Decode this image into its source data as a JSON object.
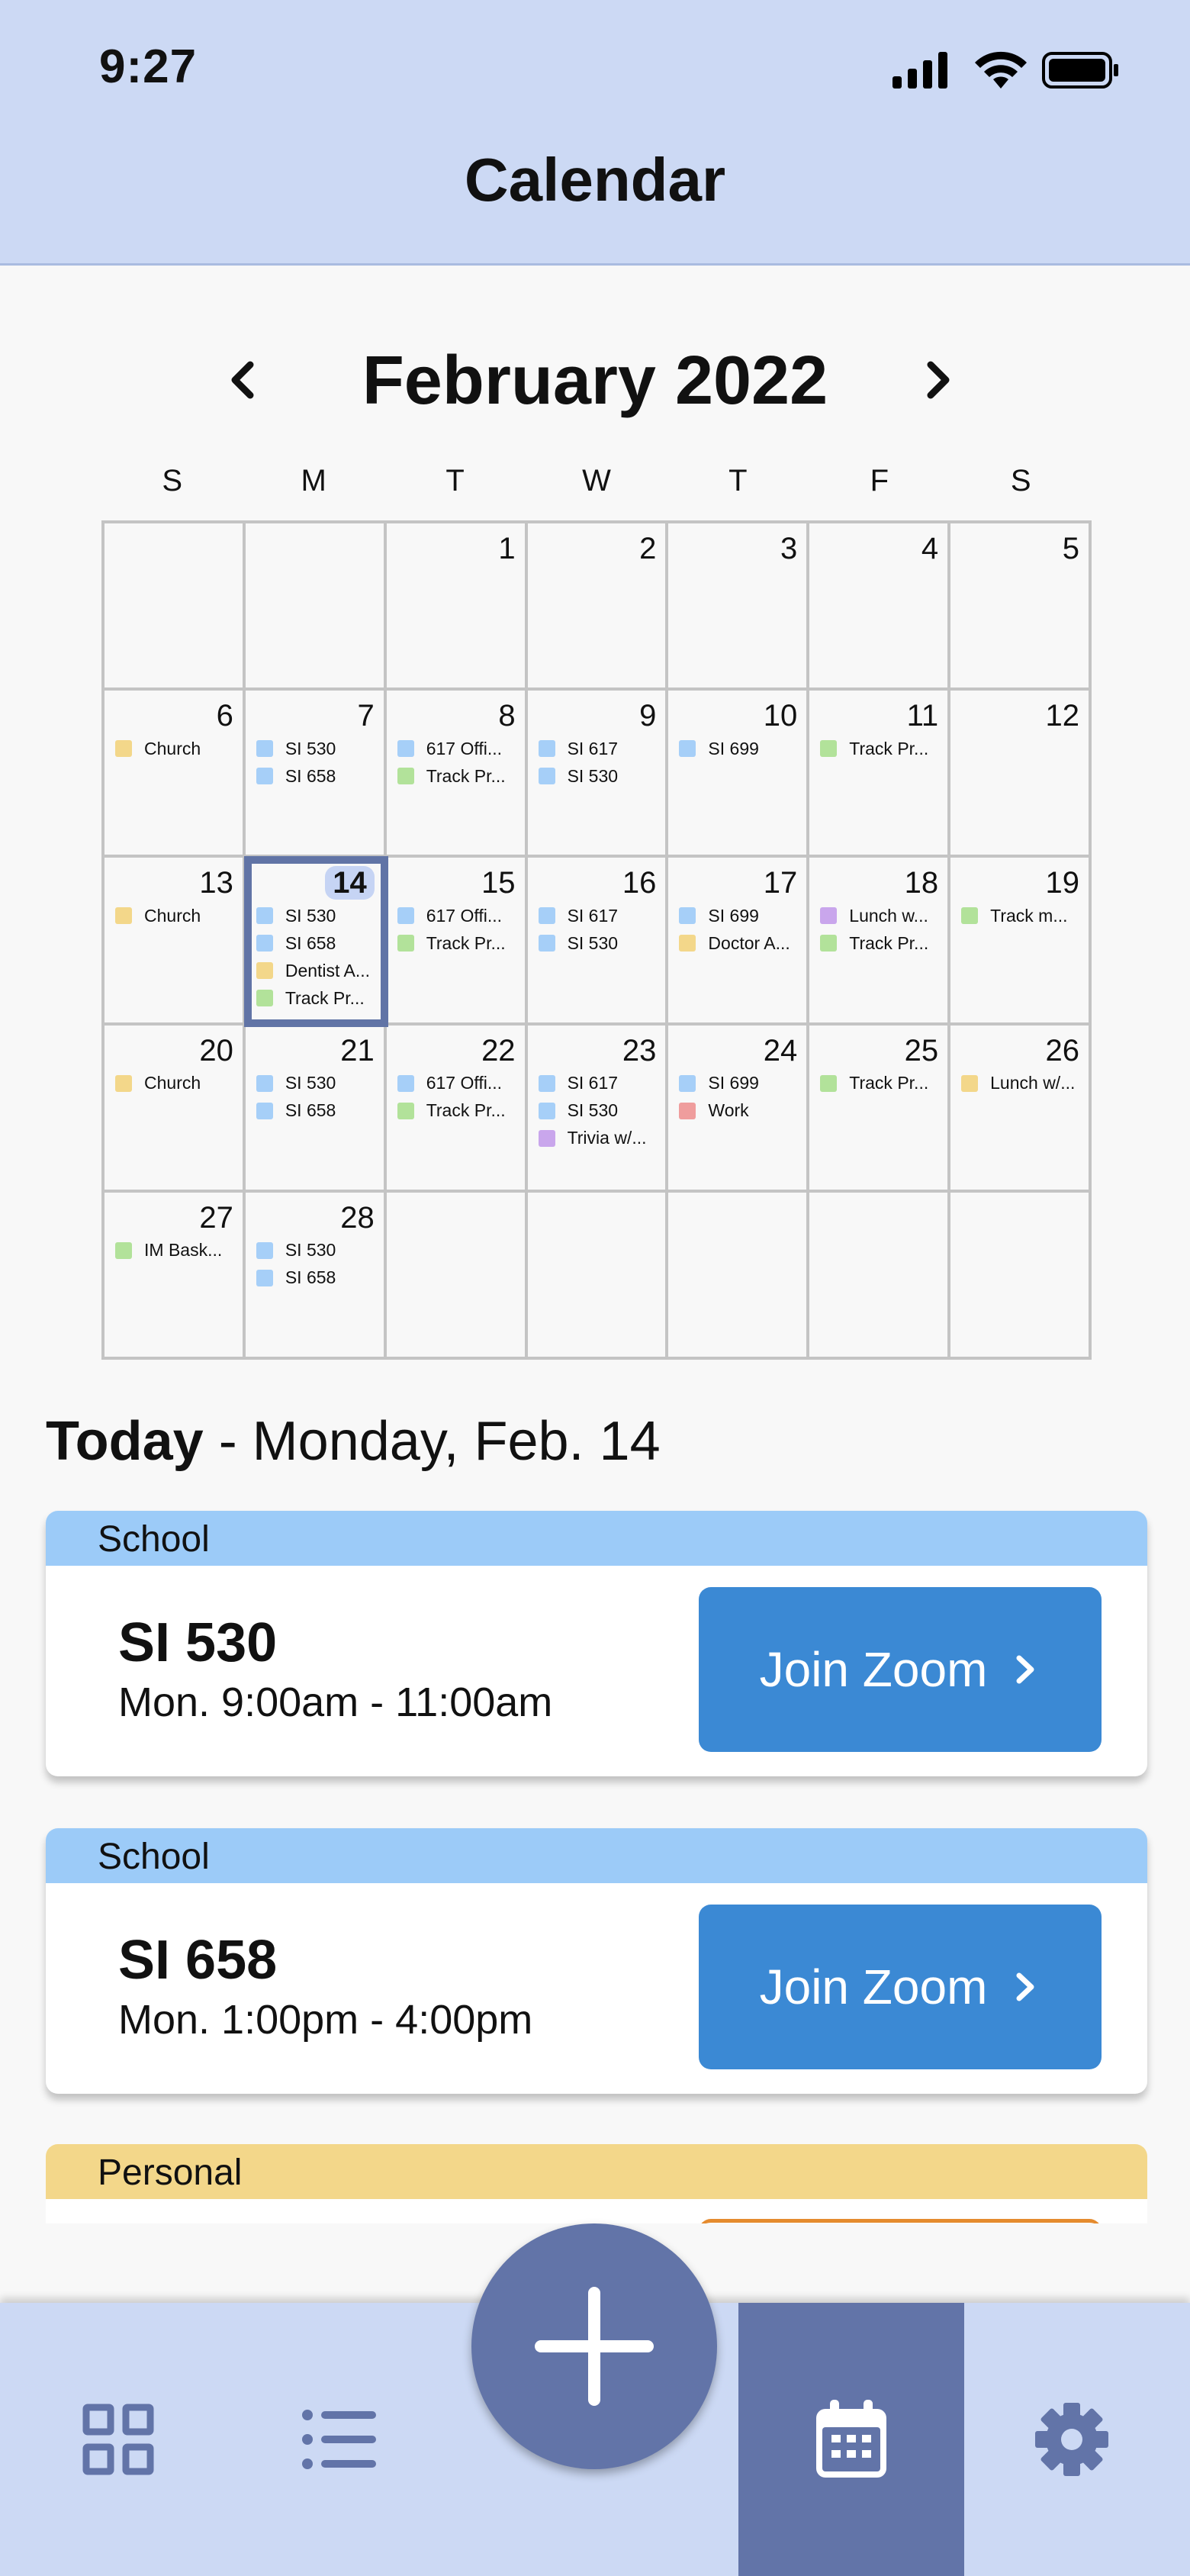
{
  "status_bar": {
    "time": "9:27"
  },
  "header": {
    "title": "Calendar"
  },
  "month": {
    "label": "February 2022"
  },
  "weekdays": [
    "S",
    "M",
    "T",
    "W",
    "T",
    "F",
    "S"
  ],
  "category_colors": {
    "school": "#a6cff8",
    "personal": "#f3d78a",
    "fitness": "#b2e29a",
    "social": "#c9a6ec",
    "work": "#ef9d9d"
  },
  "calendar": {
    "weeks": [
      [
        {
          "day": "",
          "events": []
        },
        {
          "day": "",
          "events": []
        },
        {
          "day": "1",
          "events": []
        },
        {
          "day": "2",
          "events": []
        },
        {
          "day": "3",
          "events": []
        },
        {
          "day": "4",
          "events": []
        },
        {
          "day": "5",
          "events": []
        }
      ],
      [
        {
          "day": "6",
          "events": [
            {
              "label": "Church",
              "category": "personal"
            }
          ]
        },
        {
          "day": "7",
          "events": [
            {
              "label": "SI 530",
              "category": "school"
            },
            {
              "label": "SI 658",
              "category": "school"
            }
          ]
        },
        {
          "day": "8",
          "events": [
            {
              "label": "617 Offi...",
              "category": "school"
            },
            {
              "label": "Track Pr...",
              "category": "fitness"
            }
          ]
        },
        {
          "day": "9",
          "events": [
            {
              "label": "SI 617",
              "category": "school"
            },
            {
              "label": "SI 530",
              "category": "school"
            }
          ]
        },
        {
          "day": "10",
          "events": [
            {
              "label": "SI 699",
              "category": "school"
            }
          ]
        },
        {
          "day": "11",
          "events": [
            {
              "label": "Track Pr...",
              "category": "fitness"
            }
          ]
        },
        {
          "day": "12",
          "events": []
        }
      ],
      [
        {
          "day": "13",
          "events": [
            {
              "label": "Church",
              "category": "personal"
            }
          ]
        },
        {
          "day": "14",
          "today": true,
          "events": [
            {
              "label": "SI 530",
              "category": "school"
            },
            {
              "label": "SI 658",
              "category": "school"
            },
            {
              "label": "Dentist A...",
              "category": "personal"
            },
            {
              "label": "Track Pr...",
              "category": "fitness"
            }
          ]
        },
        {
          "day": "15",
          "events": [
            {
              "label": "617 Offi...",
              "category": "school"
            },
            {
              "label": "Track Pr...",
              "category": "fitness"
            }
          ]
        },
        {
          "day": "16",
          "events": [
            {
              "label": "SI 617",
              "category": "school"
            },
            {
              "label": "SI 530",
              "category": "school"
            }
          ]
        },
        {
          "day": "17",
          "events": [
            {
              "label": "SI 699",
              "category": "school"
            },
            {
              "label": "Doctor A...",
              "category": "personal"
            }
          ]
        },
        {
          "day": "18",
          "events": [
            {
              "label": "Lunch w...",
              "category": "social"
            },
            {
              "label": "Track Pr...",
              "category": "fitness"
            }
          ]
        },
        {
          "day": "19",
          "events": [
            {
              "label": "Track m...",
              "category": "fitness"
            }
          ]
        }
      ],
      [
        {
          "day": "20",
          "events": [
            {
              "label": "Church",
              "category": "personal"
            }
          ]
        },
        {
          "day": "21",
          "events": [
            {
              "label": "SI 530",
              "category": "school"
            },
            {
              "label": "SI 658",
              "category": "school"
            }
          ]
        },
        {
          "day": "22",
          "events": [
            {
              "label": "617 Offi...",
              "category": "school"
            },
            {
              "label": "Track Pr...",
              "category": "fitness"
            }
          ]
        },
        {
          "day": "23",
          "events": [
            {
              "label": "SI 617",
              "category": "school"
            },
            {
              "label": "SI 530",
              "category": "school"
            },
            {
              "label": "Trivia w/...",
              "category": "social"
            }
          ]
        },
        {
          "day": "24",
          "events": [
            {
              "label": "SI 699",
              "category": "school"
            },
            {
              "label": "Work",
              "category": "work"
            }
          ]
        },
        {
          "day": "25",
          "events": [
            {
              "label": "Track Pr...",
              "category": "fitness"
            }
          ]
        },
        {
          "day": "26",
          "events": [
            {
              "label": "Lunch w/...",
              "category": "personal"
            }
          ]
        }
      ],
      [
        {
          "day": "27",
          "events": [
            {
              "label": "IM Bask...",
              "category": "fitness"
            }
          ]
        },
        {
          "day": "28",
          "events": [
            {
              "label": "SI 530",
              "category": "school"
            },
            {
              "label": "SI 658",
              "category": "school"
            }
          ]
        },
        {
          "day": "",
          "events": []
        },
        {
          "day": "",
          "events": []
        },
        {
          "day": "",
          "events": []
        },
        {
          "day": "",
          "events": []
        },
        {
          "day": "",
          "events": []
        }
      ]
    ]
  },
  "today": {
    "heading_bold": "Today",
    "heading_rest": " - Monday, Feb. 14",
    "cards": [
      {
        "category": "School",
        "title": "SI 530",
        "time": "Mon. 9:00am - 11:00am",
        "button": "Join Zoom"
      },
      {
        "category": "School",
        "title": "SI 658",
        "time": "Mon. 1:00pm - 4:00pm",
        "button": "Join Zoom"
      }
    ],
    "partial_card": {
      "category": "Personal"
    }
  },
  "bottom_nav": {
    "items": [
      {
        "icon": "dashboard-grid-icon"
      },
      {
        "icon": "list-icon"
      },
      {
        "icon": "add-icon"
      },
      {
        "icon": "calendar-icon",
        "active": true
      },
      {
        "icon": "gear-icon"
      }
    ]
  }
}
